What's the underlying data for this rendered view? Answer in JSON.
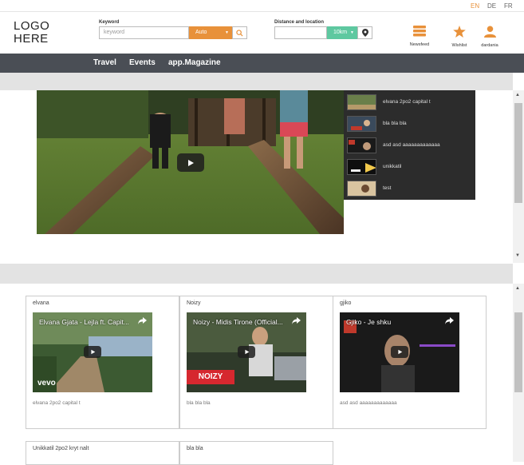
{
  "languages": [
    {
      "code": "EN",
      "active": true
    },
    {
      "code": "DE",
      "active": false
    },
    {
      "code": "FR",
      "active": false
    }
  ],
  "header": {
    "logo": "LOGO\nHERE",
    "keyword_label": "Keyword",
    "keyword_placeholder": "keyword",
    "auto_select": "Auto",
    "distance_label": "Distance and location",
    "km_select": "10km",
    "icons": [
      {
        "label": "Newsfeed",
        "icon": "stack-icon"
      },
      {
        "label": "Wishlist",
        "icon": "star-icon"
      },
      {
        "label": "dardania",
        "icon": "user-icon"
      }
    ]
  },
  "nav": [
    "Travel",
    "Events",
    "app.Magazine"
  ],
  "playlist": [
    "elvana 2po2 capital t",
    "bla bla bla",
    "asd asd aaaaaaaaaaaaa",
    "unikkatil",
    "test"
  ],
  "cards": [
    {
      "author": "elvana",
      "video_title": "Elvana Gjata - Lejla ft. Capit...",
      "caption": "elvana 2po2 capital t",
      "watermark": "vevo"
    },
    {
      "author": "Noizy",
      "video_title": "Noizy - Midis Tirone (Official...",
      "caption": "bla bla bla",
      "watermark": "NOIZY"
    },
    {
      "author": "gjiko",
      "video_title": "Gjiko - Je shku",
      "caption": "asd asd aaaaaaaaaaaaa",
      "watermark": ""
    }
  ],
  "cards_bottom": [
    "Unikkatil 2po2 kryt nalt",
    "bla bla"
  ],
  "colors": {
    "accent": "#e8913a",
    "green": "#5ec8a0",
    "nav": "#4a4e55"
  }
}
